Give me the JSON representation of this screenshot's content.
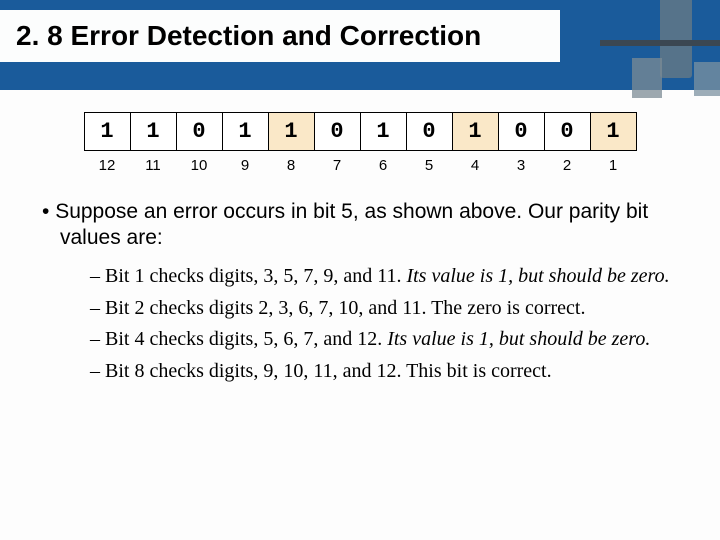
{
  "title": "2. 8 Error Detection and Correction",
  "bits": {
    "values": [
      "1",
      "1",
      "0",
      "1",
      "1",
      "0",
      "1",
      "0",
      "1",
      "0",
      "0",
      "1"
    ],
    "highlight": [
      false,
      false,
      false,
      false,
      true,
      false,
      false,
      false,
      true,
      false,
      false,
      true
    ],
    "positions": [
      "12",
      "11",
      "10",
      "9",
      "8",
      "7",
      "6",
      "5",
      "4",
      "3",
      "2",
      "1"
    ]
  },
  "para_lead": "Suppose an error occurs in bit 5, as shown above. Our parity bit values are:",
  "items": [
    {
      "plain": "Bit 1 checks digits, 3, 5, 7, 9, and 11. ",
      "em": "Its value is 1, but should be zero."
    },
    {
      "plain": "Bit 2 checks digits 2, 3, 6, 7, 10, and 11. The zero is correct.",
      "em": ""
    },
    {
      "plain": "Bit 4 checks digits, 5, 6, 7, and 12. ",
      "em": "Its value is 1, but should be zero."
    },
    {
      "plain": "Bit 8 checks digits, 9, 10, 11, and 12. This bit is correct.",
      "em": ""
    }
  ]
}
